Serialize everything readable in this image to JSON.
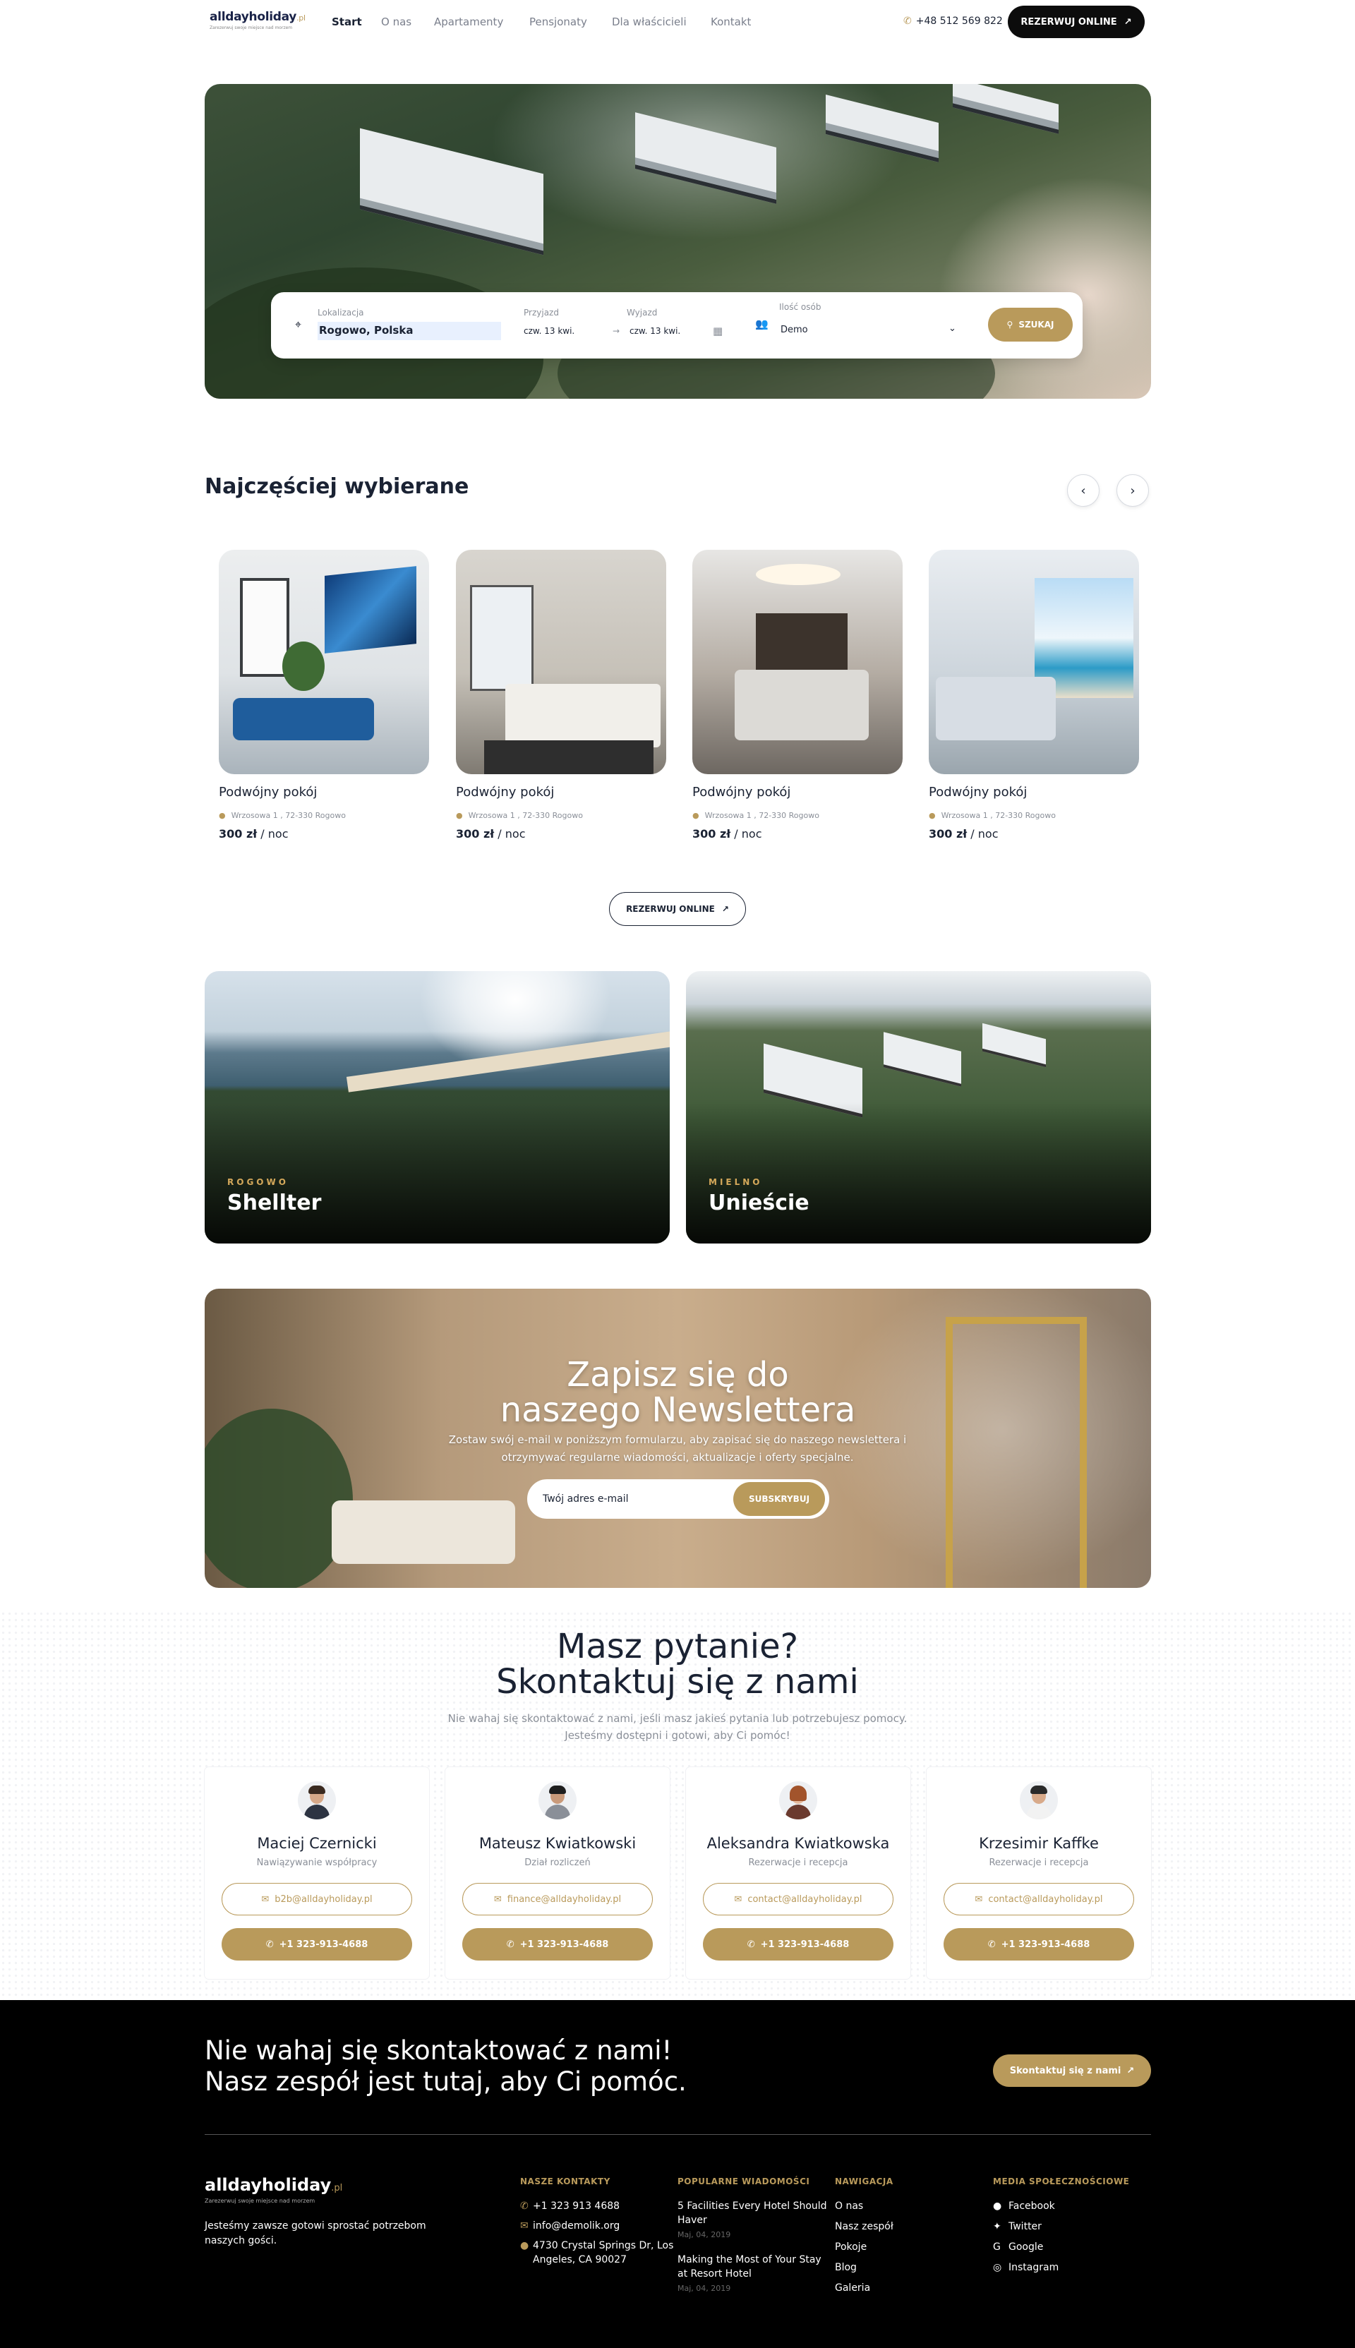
{
  "header": {
    "logo": "alldayholiday",
    "logo_suffix": ".pl",
    "logo_tagline": "Zarezerwuj swoje miejsce nad morzem",
    "nav": [
      "Start",
      "O nas",
      "Apartamenty",
      "Pensjonaty",
      "Dla właścicieli",
      "Kontakt"
    ],
    "phone": "+48 512 569 822",
    "cta": "REZERWUJ ONLINE"
  },
  "search": {
    "location_label": "Lokalizacja",
    "location_value": "Rogowo, Polska",
    "arrival_label": "Przyjazd",
    "arrival_value": "czw. 13 kwi.",
    "departure_label": "Wyjazd",
    "departure_value": "czw. 13 kwi.",
    "guests_label": "Ilość osób",
    "guests_value": "Demo",
    "button": "SZUKAJ"
  },
  "popular": {
    "title": "Najczęściej wybierane",
    "rooms": [
      {
        "title": "Podwójny pokój",
        "address": "Wrzosowa 1 , 72-330 Rogowo",
        "price": "300 zł",
        "unit": " / noc"
      },
      {
        "title": "Podwójny pokój",
        "address": "Wrzosowa 1 , 72-330 Rogowo",
        "price": "300 zł",
        "unit": " / noc"
      },
      {
        "title": "Podwójny pokój",
        "address": "Wrzosowa 1 , 72-330 Rogowo",
        "price": "300 zł",
        "unit": " / noc"
      },
      {
        "title": "Podwójny pokój",
        "address": "Wrzosowa 1 , 72-330 Rogowo",
        "price": "300 zł",
        "unit": " / noc"
      }
    ],
    "cta": "REZERWUJ ONLINE"
  },
  "destinations": [
    {
      "kicker": "ROGOWO",
      "name": "Shellter"
    },
    {
      "kicker": "MIELNO",
      "name": "Unieście"
    }
  ],
  "newsletter": {
    "title_line1": "Zapisz się do",
    "title_line2": "naszego Newslettera",
    "desc_line1": "Zostaw swój e-mail w poniższym formularzu, aby zapisać się do naszego newslettera i",
    "desc_line2": "otrzymywać regularne wiadomości, aktualizacje i oferty specjalne.",
    "placeholder": "Twój adres e-mail",
    "button": "SUBSKRYBUJ"
  },
  "contact": {
    "title_line1": "Masz pytanie?",
    "title_line2": "Skontaktuj się z nami",
    "desc_line1": "Nie wahaj się skontaktować z nami, jeśli masz jakieś pytania lub potrzebujesz pomocy.",
    "desc_line2": "Jesteśmy dostępni i gotowi, aby Ci pomóc!",
    "people": [
      {
        "name": "Maciej Czernicki",
        "role": "Nawiązywanie współpracy",
        "email": "b2b@alldayholiday.pl",
        "phone": "+1 323-913-4688"
      },
      {
        "name": "Mateusz Kwiatkowski",
        "role": "Dział rozliczeń",
        "email": "finance@alldayholiday.pl",
        "phone": "+1 323-913-4688"
      },
      {
        "name": "Aleksandra Kwiatkowska",
        "role": "Rezerwacje i recepcja",
        "email": "contact@alldayholiday.pl",
        "phone": "+1 323-913-4688"
      },
      {
        "name": "Krzesimir Kaffke",
        "role": "Rezerwacje i recepcja",
        "email": "contact@alldayholiday.pl",
        "phone": "+1 323-913-4688"
      }
    ]
  },
  "footer": {
    "cta_line1": "Nie wahaj się skontaktować z nami!",
    "cta_line2": "Nasz zespół jest tutaj, aby Ci pomóc.",
    "cta_button": "Skontaktuj się z nami",
    "logo": "alldayholiday",
    "logo_suffix": ".pl",
    "logo_tagline": "Zarezerwuj swoje miejsce nad morzem",
    "about": "Jesteśmy zawsze gotowi sprostać potrzebom naszych gości.",
    "contacts_title": "NASZE KONTAKTY",
    "contact_phone": "+1 323 913 4688",
    "contact_email": "info@demolik.org",
    "contact_address": "4730 Crystal Springs Dr, Los Angeles, CA 90027",
    "news_title": "POPULARNE WIADOMOŚCI",
    "news": [
      {
        "title": "5 Facilities Every Hotel Should Haver",
        "date": "Maj, 04, 2019"
      },
      {
        "title": "Making the Most of Your Stay at Resort Hotel",
        "date": "Maj, 04, 2019"
      }
    ],
    "nav_title": "NAWIGACJA",
    "nav": [
      "O nas",
      "Nasz zespół",
      "Pokoje",
      "Blog",
      "Galeria"
    ],
    "social_title": "MEDIA SPOŁECZNOŚCIOWE",
    "social": [
      "Facebook",
      "Twitter",
      "Google",
      "Instagram"
    ]
  },
  "colors": {
    "gold": "#b99a5b",
    "dark": "#1a2233",
    "footer_bg": "#000000"
  }
}
